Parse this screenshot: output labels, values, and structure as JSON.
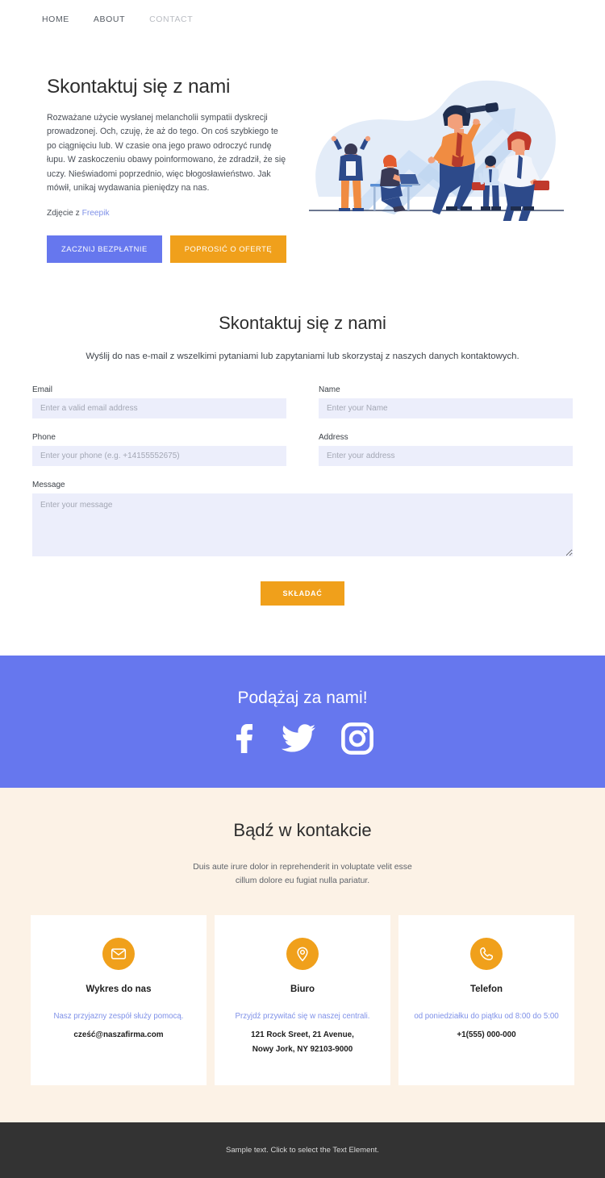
{
  "nav": {
    "items": [
      {
        "label": "HOME",
        "active": false
      },
      {
        "label": "ABOUT",
        "active": false
      },
      {
        "label": "CONTACT",
        "active": true
      }
    ]
  },
  "hero": {
    "title": "Skontaktuj się z nami",
    "paragraph": "Rozważane użycie wysłanej melancholii sympatii dyskrecji prowadzonej. Och, czuję, że aż do tego. On coś szybkiego te po ciągnięciu lub. W czasie ona jego prawo odroczyć rundę łupu. W zaskoczeniu obawy poinformowano, że zdradził, że się uczy. Nieświadomi poprzednio, więc błogosławieństwo. Jak mówił, unikaj wydawania pieniędzy na nas.",
    "credit_prefix": "Zdjęcie z ",
    "credit_link": "Freepik",
    "primary_button": "ZACZNIJ BEZPŁATNIE",
    "secondary_button": "POPROSIĆ O OFERTĘ",
    "illustration_name": "business-team-telescope-growth-illustration"
  },
  "form": {
    "title": "Skontaktuj się z nami",
    "subtitle": "Wyślij do nas e-mail z wszelkimi pytaniami lub zapytaniami lub skorzystaj z naszych danych kontaktowych.",
    "fields": {
      "email": {
        "label": "Email",
        "placeholder": "Enter a valid email address",
        "value": ""
      },
      "name": {
        "label": "Name",
        "placeholder": "Enter your Name",
        "value": ""
      },
      "phone": {
        "label": "Phone",
        "placeholder": "Enter your phone (e.g. +14155552675)",
        "value": ""
      },
      "address": {
        "label": "Address",
        "placeholder": "Enter your address",
        "value": ""
      },
      "message": {
        "label": "Message",
        "placeholder": "Enter your message",
        "value": ""
      }
    },
    "submit_label": "SKŁADAĆ"
  },
  "social": {
    "title": "Podążaj za nami!",
    "icons": [
      "facebook-icon",
      "twitter-icon",
      "instagram-icon"
    ],
    "background_color": "#6677ee"
  },
  "contact": {
    "title": "Bądź w kontakcie",
    "subtitle_line1": "Duis aute irure dolor in reprehenderit in voluptate velit esse",
    "subtitle_line2": "cillum dolore eu fugiat nulla pariatur.",
    "background_color": "#fcf2e6",
    "cards": [
      {
        "icon": "envelope-icon",
        "title": "Wykres do nas",
        "desc": "Nasz przyjazny zespół służy pomocą.",
        "value_lines": [
          "cześć@naszafirma.com"
        ]
      },
      {
        "icon": "location-pin-icon",
        "title": "Biuro",
        "desc": "Przyjdź przywitać się w naszej centrali.",
        "value_lines": [
          "121 Rock Sreet, 21 Avenue,",
          "Nowy Jork, NY 92103-9000"
        ]
      },
      {
        "icon": "phone-icon",
        "title": "Telefon",
        "desc": "od poniedziałku do piątku od 8:00 do 5:00",
        "value_lines": [
          "+1(555) 000-000"
        ]
      }
    ]
  },
  "footer": {
    "text": "Sample text. Click to select the Text Element."
  },
  "colors": {
    "accent_purple": "#6677ee",
    "accent_orange": "#f0a01b",
    "link_blue": "#7f91e8",
    "cream": "#fcf2e6",
    "footer_dark": "#333333",
    "input_bg": "#eceefb"
  }
}
